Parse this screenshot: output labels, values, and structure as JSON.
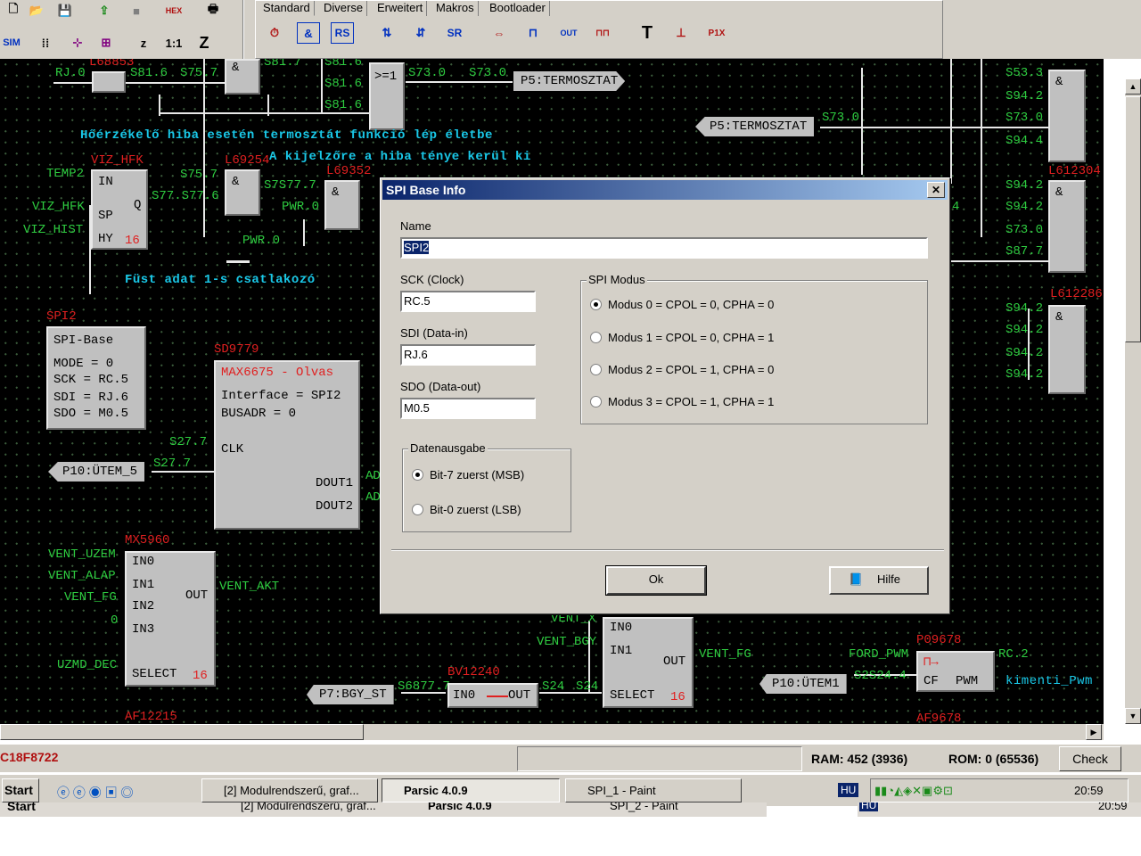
{
  "toolbar": {
    "tabs": [
      "Standard",
      "Diverse",
      "Erweitert",
      "Makros",
      "Bootloader"
    ],
    "sim": "SIM",
    "z": "z",
    "ratio": "1:1",
    "z2": "Z"
  },
  "canvas": {
    "labels": {
      "rj0": "RJ.0",
      "s816a": "S81.6",
      "s757a": "S75.7",
      "s817": "S81.7",
      "s816b": "S81.6",
      "s816c": "S81.6",
      "s816d": "S81.6",
      "or": ">=1",
      "s730a": "S73.0",
      "s730b": "S73.0",
      "p5a": "P5:TERMOSZTAT",
      "p5b": "P5:TERMOSZTAT",
      "s730c": "S73.0",
      "temp2": "TEMP2",
      "vizhfk1": "VIZ_HFK",
      "vizhfk2": "VIZ_HFK",
      "vizhist": "VIZ_HIST",
      "s757b": "S75.7",
      "s7776": "S77.S77.6",
      "s7877": "S7S77.7",
      "pwr0a": "PWR.0",
      "pwr0b": "PWR.0",
      "and1": "&",
      "and2": "&",
      "and3": "&",
      "spi2": "SPI2",
      "sd9779": "SD9779",
      "s277a": "S27.7",
      "s277b": "S27.7",
      "p10utem5": "P10:ÜTEM_5",
      "mx5960": "MX5960",
      "ventuzem": "VENT_UZEM",
      "ventalap": "VENT_ALAP",
      "ventfg": "VENT_FG",
      "zero": "0",
      "uzmddec": "UZMD_DEC",
      "ventakt": "VENT_AKT",
      "ventx": "VENT_X",
      "ventbgy": "VENT_BGY",
      "ventfg2": "VENT_FG",
      "bv12240": "BV12240",
      "p7bgyst": "P7:BGY_ST",
      "s6777": "S6877.7",
      "s24a": "S24",
      "s24b": "S24",
      "af12215": "AF12215",
      "fordpwm": "FORD_PWM",
      "s2924": "S2S24.4",
      "p10utem1": "P10:ÜTEM1",
      "rc2": "RC.2",
      "kimentipwm": "kimenti_Pwm",
      "p09678": "P09678",
      "af9678": "AF9678",
      "ad1": "AD",
      "ad2": "AD",
      "r533": "S53.3",
      "r942a": "S94.2",
      "r730a": "S73.0",
      "r944": "S94.4",
      "r942b": "S94.2",
      "r942c": "S94.2",
      "r730b": "S73.0",
      "r877": "S87.7",
      "r942d": "S94.2",
      "r942e": "S94.2",
      "r942f": "S94.2",
      "r942g": "S94.2",
      "l61230": "L612304",
      "l61228": "L612286",
      "l69254": "L69254",
      "l69352": "L69352",
      "l68853": "L68853",
      "four": "4"
    },
    "comment1": "Hőérzékelő hiba esetén termosztát funkció lép életbe",
    "comment2": "A kijelzőre a hiba ténye kerül ki",
    "comment3": "Füst adat 1-s csatlakozó",
    "hyst": {
      "in": "IN",
      "sp": "SP",
      "hy": "HY",
      "q": "Q",
      "num": "16"
    },
    "spibase": {
      "title": "SPI-Base",
      "l1": "MODE = 0",
      "l2": "SCK  = RC.5",
      "l3": "SDI  = RJ.6",
      "l4": "SDO  = M0.5"
    },
    "max": {
      "title": "MAX6675 - Olvas",
      "l1": "Interface = SPI2",
      "l2": "BUSADR    = 0",
      "clk": "CLK",
      "d1": "DOUT1",
      "d2": "DOUT2"
    },
    "mux1": {
      "in0": "IN0",
      "in1": "IN1",
      "in2": "IN2",
      "in3": "IN3",
      "out": "OUT",
      "sel": "SELECT",
      "num": "16"
    },
    "mux2": {
      "in0": "IN0",
      "in1": "IN1",
      "out": "OUT",
      "sel": "SELECT",
      "num": "16"
    },
    "bv": {
      "in0": "IN0",
      "out": "OUT"
    },
    "pwm": {
      "cf": "CF",
      "pwm": "PWM"
    }
  },
  "dialog": {
    "title": "SPI Base Info",
    "close": "✕",
    "name_label": "Name",
    "name_value": "SPI2",
    "sck_label": "SCK (Clock)",
    "sck_value": "RC.5",
    "sdi_label": "SDI (Data-in)",
    "sdi_value": "RJ.6",
    "sdo_label": "SDO (Data-out)",
    "sdo_value": "M0.5",
    "spi_modus": "SPI Modus",
    "modes": [
      "Modus 0 = CPOL = 0, CPHA = 0",
      "Modus 1 = CPOL = 0, CPHA = 1",
      "Modus 2 = CPOL = 1, CPHA = 0",
      "Modus 3 = CPOL = 1, CPHA = 1"
    ],
    "datenausgabe": "Datenausgabe",
    "msb": "Bit-7 zuerst (MSB)",
    "lsb": "Bit-0 zuerst (LSB)",
    "ok": "Ok",
    "hilfe": "Hilfe"
  },
  "status": {
    "addr": "C18F8722",
    "ram": "RAM: 452 (3936)",
    "rom": "ROM: 0 (65536)",
    "check": "Check"
  },
  "taskbar": {
    "start": "Start",
    "t1": "[2] Modulrendszerű, graf...",
    "t2": "Parsic 4.0.9",
    "t3": "SPI_1 - Paint",
    "lang": "HU",
    "time": "20:59",
    "ghost_start": "Start",
    "ghost_t1": "[2] Modulrendszerű, graf...",
    "ghost_t2": "Parsic 4.0.9",
    "ghost_t3": "SPI_2 - Paint",
    "ghost_lang": "HU",
    "ghost_time": "20:59"
  }
}
